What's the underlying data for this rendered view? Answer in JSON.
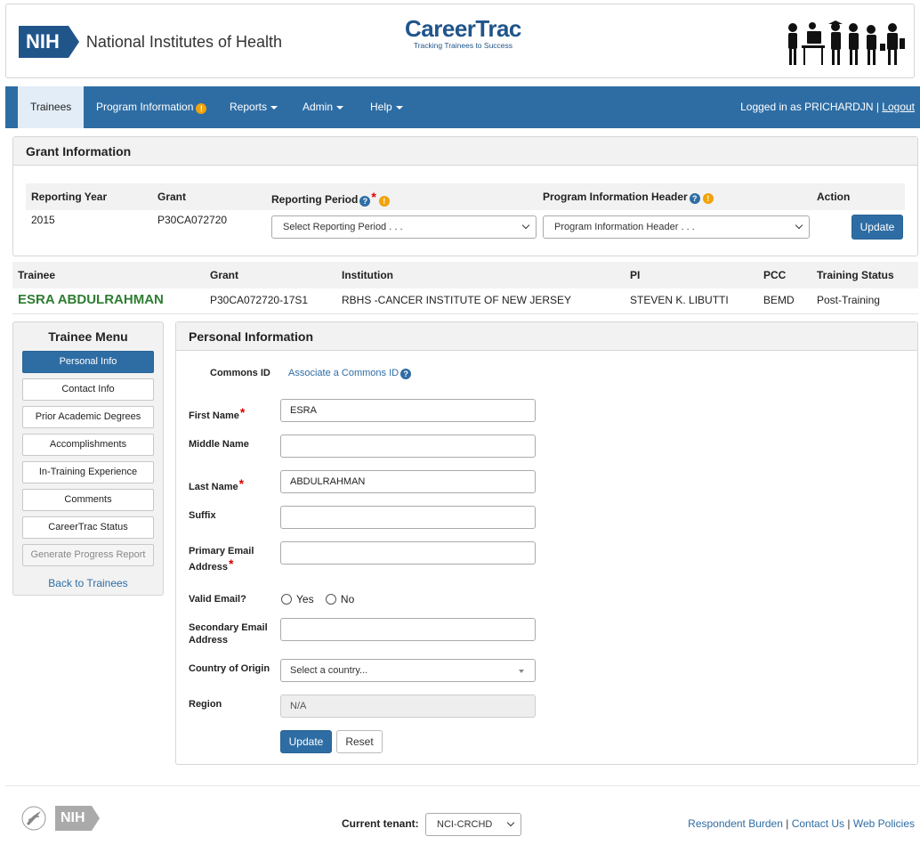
{
  "header": {
    "nih_badge": "NIH",
    "nih_name": "National Institutes of Health",
    "product_title": "CareerTrac",
    "product_subtitle": "Tracking Trainees to Success"
  },
  "nav": {
    "items": [
      {
        "label": "Trainees",
        "active": true
      },
      {
        "label": "Program Information"
      },
      {
        "label": "Reports"
      },
      {
        "label": "Admin"
      },
      {
        "label": "Help"
      }
    ],
    "user_text": "Logged in as PRICHARDJN |",
    "logout_label": "Logout"
  },
  "grant_info": {
    "title": "Grant Information",
    "columns": [
      "Reporting Year",
      "Grant",
      "Reporting Period",
      "Program Information Header",
      "Action"
    ],
    "row": {
      "reporting_year": "2015",
      "grant": "P30CA072720"
    },
    "reporting_period_placeholder": "Select Reporting Period . . .",
    "program_header_placeholder": "Program Information Header . . .",
    "update_label": "Update"
  },
  "trainee_table": {
    "columns": [
      "Trainee",
      "Grant",
      "Institution",
      "PI",
      "PCC",
      "Training Status"
    ],
    "row": {
      "trainee": "ESRA ABDULRAHMAN",
      "grant": "P30CA072720-17S1",
      "institution": "RBHS -CANCER INSTITUTE OF NEW JERSEY",
      "pi": "STEVEN K. LIBUTTI",
      "pcc": "BEMD",
      "training_status": "Post-Training"
    }
  },
  "trainee_menu": {
    "title": "Trainee Menu",
    "items": [
      "Personal Info",
      "Contact Info",
      "Prior Academic Degrees",
      "Accomplishments",
      "In-Training Experience",
      "Comments",
      "CareerTrac Status",
      "Generate Progress Report"
    ],
    "back_label": "Back to Trainees"
  },
  "personal_info": {
    "title": "Personal Information",
    "commons_id_label": "Commons ID",
    "commons_id_link": "Associate a Commons ID",
    "first_name_label": "First Name",
    "first_name_value": "ESRA",
    "middle_name_label": "Middle Name",
    "middle_name_value": "",
    "last_name_label": "Last Name",
    "last_name_value": "ABDULRAHMAN",
    "suffix_label": "Suffix",
    "suffix_value": "",
    "primary_email_label_1": "Primary Email",
    "primary_email_label_2": "Address",
    "primary_email_value": "",
    "valid_email_label": "Valid Email?",
    "valid_email_yes": "Yes",
    "valid_email_no": "No",
    "secondary_email_label_1": "Secondary Email",
    "secondary_email_label_2": "Address",
    "secondary_email_value": "",
    "country_label": "Country of Origin",
    "country_placeholder": "Select a country...",
    "region_label": "Region",
    "region_value": "N/A",
    "update_label": "Update",
    "reset_label": "Reset"
  },
  "footer": {
    "nih_badge": "NIH",
    "tenant_label": "Current tenant:",
    "tenant_value": "NCI-CRCHD",
    "links": [
      "Respondent Burden",
      "Contact Us",
      "Web Policies"
    ]
  }
}
